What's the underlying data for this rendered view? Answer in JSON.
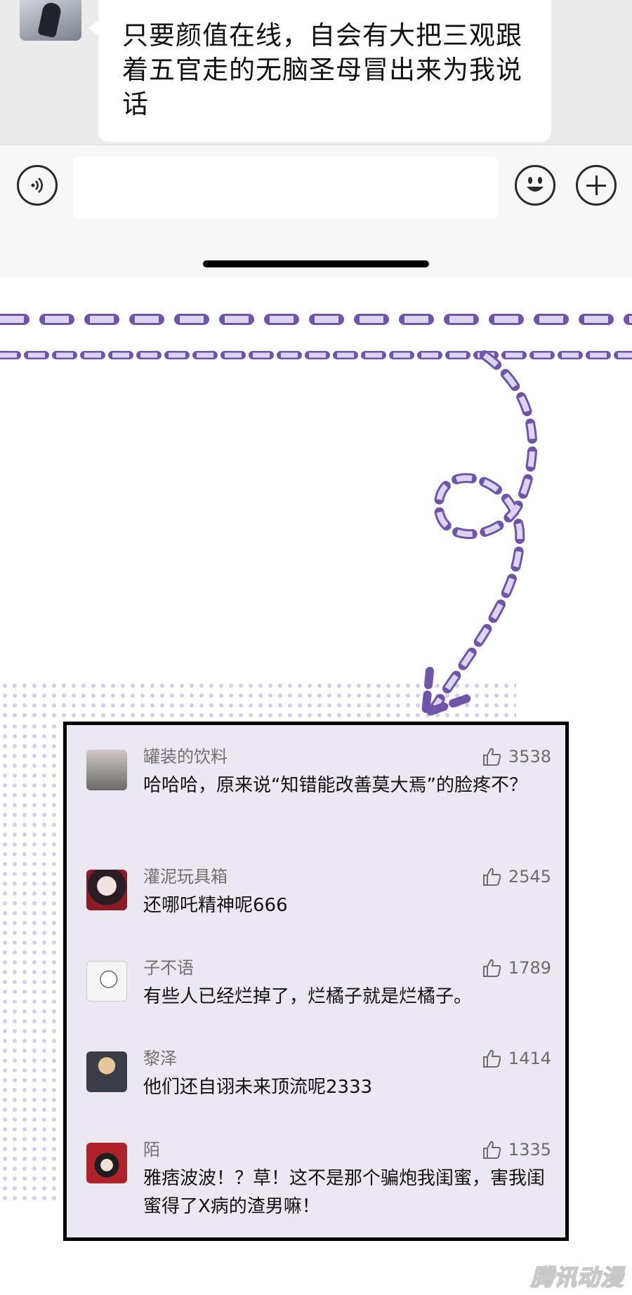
{
  "chat": {
    "message_text": "只要颜值在线，自会有大把三观跟着五官走的无脑圣母冒出来为我说话"
  },
  "input_bar": {
    "placeholder": ""
  },
  "comments": [
    {
      "username": "罐装的饮料",
      "likes": "3538",
      "text": "哈哈哈，原来说“知错能改善莫大焉”的脸疼不？",
      "avatar_color": "#8d8a88"
    },
    {
      "username": "灌泥玩具箱",
      "likes": "2545",
      "text": "还哪吒精神呢666",
      "avatar_color": "#5a2b33"
    },
    {
      "username": "子不语",
      "likes": "1789",
      "text": "有些人已经烂掉了，烂橘子就是烂橘子。",
      "avatar_color": "#e8e8e8"
    },
    {
      "username": "黎泽",
      "likes": "1414",
      "text": "他们还自诩未来顶流呢2333",
      "avatar_color": "#6b6f78"
    },
    {
      "username": "陌",
      "likes": "1335",
      "text": "雅痞波波！？草！这不是那个骗炮我闺蜜，害我闺蜜得了X病的渣男嘛！",
      "avatar_color": "#b0222a"
    }
  ],
  "watermark": "腾讯动漫",
  "colors": {
    "accent_purple": "#b8a6e0",
    "accent_purple_stroke": "#6e55a8",
    "panel_bg": "#ebe8f1",
    "chat_bg": "#ebebeb"
  }
}
